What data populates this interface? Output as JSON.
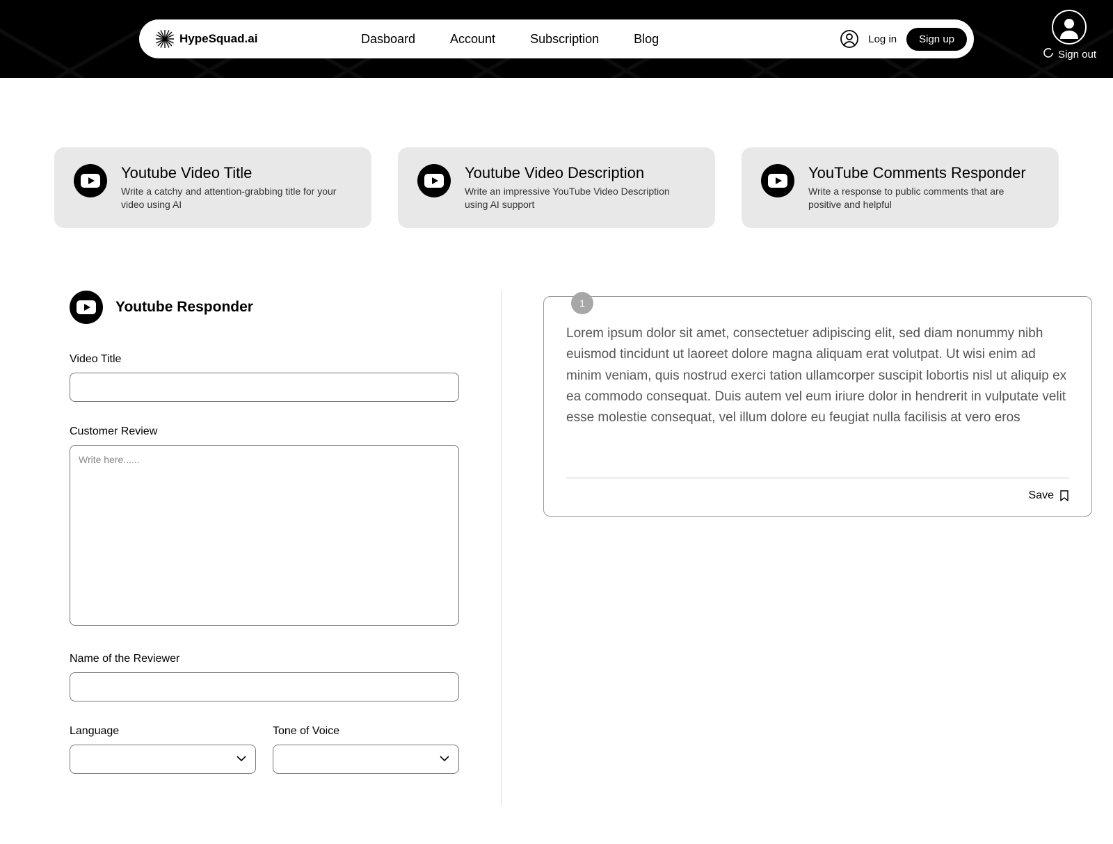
{
  "header": {
    "brand": "HypeSquad.ai",
    "nav": {
      "dashboard": "Dasboard",
      "account": "Account",
      "subscription": "Subscription",
      "blog": "Blog"
    },
    "login": "Log in",
    "signup": "Sign up",
    "signout": "Sign out"
  },
  "cards": {
    "title1": "Youtube Video Title",
    "desc1": "Write a catchy and attention-grabbing title for your video using AI",
    "title2": "Youtube Video Description",
    "desc2": "Write an impressive YouTube Video Description using AI support",
    "title3": "YouTube Comments Responder",
    "desc3": "Write a response to public comments that are positive and helpful"
  },
  "form": {
    "section_title": "Youtube Responder",
    "video_title_label": "Video Title",
    "video_title_value": "",
    "review_label": "Customer Review",
    "review_placeholder": "Write here......",
    "review_value": "",
    "reviewer_label": "Name of the Reviewer",
    "reviewer_value": "",
    "language_label": "Language",
    "language_value": "",
    "tone_label": "Tone of Voice",
    "tone_value": ""
  },
  "result": {
    "index": "1",
    "body": "Lorem ipsum dolor sit amet, consectetuer adipiscing elit, sed diam nonummy nibh euismod tincidunt ut laoreet dolore magna aliquam erat volutpat. Ut wisi enim ad minim veniam, quis nostrud exerci tation ullamcorper suscipit lobortis nisl ut aliquip ex ea commodo consequat. Duis autem vel eum iriure dolor in hendrerit in vulputate velit esse molestie consequat, vel illum dolore eu feugiat nulla facilisis at vero eros",
    "save_label": "Save"
  }
}
